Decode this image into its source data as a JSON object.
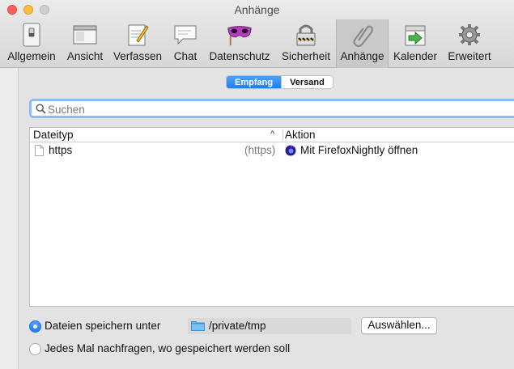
{
  "window": {
    "title": "Anhänge"
  },
  "toolbar": {
    "items": [
      {
        "label": "Allgemein",
        "icon": "switch-icon"
      },
      {
        "label": "Ansicht",
        "icon": "window-icon"
      },
      {
        "label": "Verfassen",
        "icon": "compose-icon"
      },
      {
        "label": "Chat",
        "icon": "chat-bubble-icon"
      },
      {
        "label": "Datenschutz",
        "icon": "mask-icon"
      },
      {
        "label": "Sicherheit",
        "icon": "padlock-icon"
      },
      {
        "label": "Anhänge",
        "icon": "paperclip-icon",
        "selected": true
      },
      {
        "label": "Kalender",
        "icon": "calendar-icon"
      },
      {
        "label": "Erweitert",
        "icon": "gear-icon"
      }
    ]
  },
  "tabs": {
    "incoming": "Empfang",
    "outgoing": "Versand",
    "active": "Empfang"
  },
  "search": {
    "placeholder": "Suchen",
    "value": ""
  },
  "table": {
    "headers": {
      "type": "Dateityp",
      "action": "Aktion"
    },
    "rows": [
      {
        "type": "https",
        "ext": "(https)",
        "action": "Mit FirefoxNightly öffnen"
      }
    ]
  },
  "save": {
    "option_save": "Dateien speichern unter",
    "option_ask": "Jedes Mal nachfragen, wo gespeichert werden soll",
    "selected": "option_save",
    "path": "/private/tmp",
    "choose_label": "Auswählen..."
  },
  "colors": {
    "accent": "#1f7ef5",
    "search_focus": "#8fbaf3"
  }
}
